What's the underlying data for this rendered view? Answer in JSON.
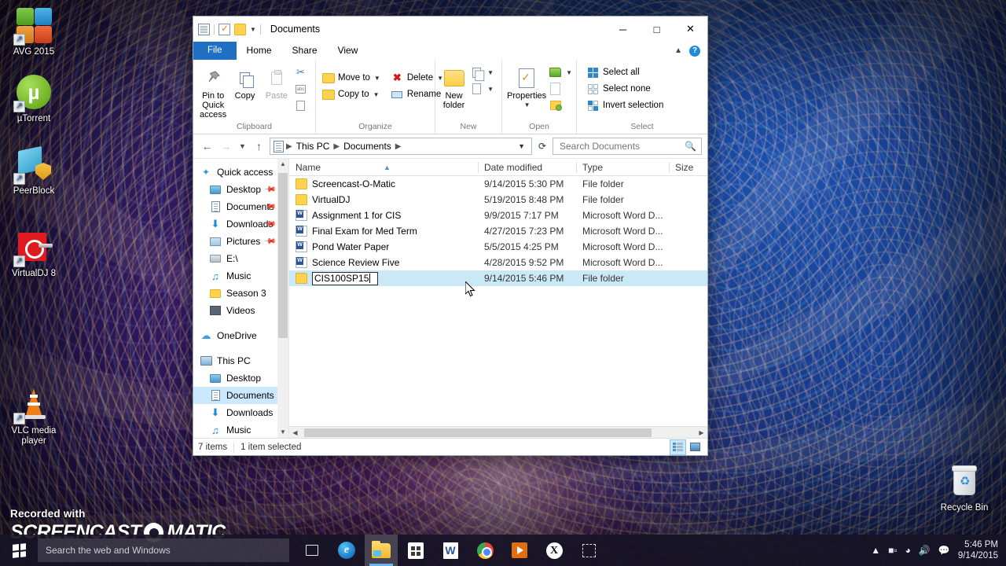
{
  "desktop": {
    "icons": [
      {
        "label": "AVG 2015",
        "icon": "avg-icon"
      },
      {
        "label": "µTorrent",
        "icon": "utorrent-icon"
      },
      {
        "label": "PeerBlock",
        "icon": "peerblock-icon"
      },
      {
        "label": "VirtualDJ 8",
        "icon": "virtualdj-icon"
      },
      {
        "label": "VLC media player",
        "icon": "vlc-icon"
      },
      {
        "label": "Recycle Bin",
        "icon": "recycle-bin-icon"
      }
    ]
  },
  "watermark": {
    "line1": "Recorded with",
    "word1": "SCREENCAST",
    "word2": "MATIC"
  },
  "explorer": {
    "title": "Documents",
    "quick_access_toolbar": [
      {
        "icon": "properties-document-icon"
      },
      {
        "icon": "checked-document-icon"
      },
      {
        "icon": "folder-icon"
      },
      {
        "icon": "chevron-down-icon"
      }
    ],
    "window_controls": {
      "minimize": "─",
      "maximize": "□",
      "close": "✕"
    },
    "tabs": [
      {
        "label": "File",
        "state": "file"
      },
      {
        "label": "Home",
        "state": "active"
      },
      {
        "label": "Share",
        "state": "normal"
      },
      {
        "label": "View",
        "state": "normal"
      }
    ],
    "ribbon": {
      "collapse_icon": "chevron-up-icon",
      "help_icon": "help-icon",
      "help_label": "?",
      "groups": [
        {
          "name": "Clipboard",
          "big_buttons": [
            {
              "label": "Pin to Quick access",
              "icon": "pin-icon",
              "disabled": false
            },
            {
              "label": "Copy",
              "icon": "copy-icon",
              "disabled": false
            },
            {
              "label": "Paste",
              "icon": "paste-icon",
              "disabled": true
            }
          ],
          "small_buttons": [
            {
              "label": "",
              "icon": "cut-scissors-icon"
            },
            {
              "label": "",
              "icon": "copy-path-icon"
            },
            {
              "label": "",
              "icon": "paste-shortcut-icon"
            }
          ]
        },
        {
          "name": "Organize",
          "small_buttons": [
            {
              "label": "Move to",
              "icon": "move-to-icon",
              "caret": true
            },
            {
              "label": "Delete",
              "icon": "delete-x-icon",
              "caret": true
            },
            {
              "label": "Copy to",
              "icon": "copy-to-icon",
              "caret": true
            },
            {
              "label": "Rename",
              "icon": "rename-icon",
              "caret": false
            }
          ]
        },
        {
          "name": "New",
          "big_buttons": [
            {
              "label": "New folder",
              "icon": "new-folder-icon"
            }
          ],
          "small_buttons": [
            {
              "label": "",
              "icon": "new-item-icon",
              "caret": true
            },
            {
              "label": "",
              "icon": "easy-access-icon",
              "caret": true
            }
          ]
        },
        {
          "name": "Open",
          "big_buttons": [
            {
              "label": "Properties",
              "icon": "properties-icon",
              "caret": true
            }
          ],
          "small_buttons": [
            {
              "label": "",
              "icon": "open-icon",
              "caret": true
            },
            {
              "label": "",
              "icon": "edit-icon",
              "caret": false
            },
            {
              "label": "",
              "icon": "history-icon",
              "caret": false
            }
          ]
        },
        {
          "name": "Select",
          "small_buttons": [
            {
              "label": "Select all",
              "icon": "select-all-icon"
            },
            {
              "label": "Select none",
              "icon": "select-none-icon"
            },
            {
              "label": "Invert selection",
              "icon": "invert-selection-icon"
            }
          ]
        }
      ]
    },
    "address_bar": {
      "back_icon": "back-arrow-icon",
      "forward_icon": "forward-arrow-icon",
      "recent_icon": "chevron-down-icon",
      "up_icon": "up-arrow-icon",
      "breadcrumb_icon": "documents-icon",
      "breadcrumbs": [
        "This PC",
        "Documents"
      ],
      "dropdown_icon": "chevron-down-icon",
      "refresh_icon": "refresh-icon",
      "search_placeholder": "Search Documents",
      "search_value": "",
      "search_icon": "search-icon"
    },
    "nav_pane": {
      "items": [
        {
          "label": "Quick access",
          "icon": "star-icon",
          "indent": false,
          "pinned": false,
          "selected": false
        },
        {
          "label": "Desktop",
          "icon": "desktop-icon",
          "indent": true,
          "pinned": true,
          "selected": false
        },
        {
          "label": "Documents",
          "icon": "documents-icon",
          "indent": true,
          "pinned": true,
          "selected": false
        },
        {
          "label": "Downloads",
          "icon": "downloads-icon",
          "indent": true,
          "pinned": true,
          "selected": false
        },
        {
          "label": "Pictures",
          "icon": "pictures-icon",
          "indent": true,
          "pinned": true,
          "selected": false
        },
        {
          "label": "E:\\",
          "icon": "drive-icon",
          "indent": true,
          "pinned": false,
          "selected": false
        },
        {
          "label": "Music",
          "icon": "music-icon",
          "indent": true,
          "pinned": false,
          "selected": false
        },
        {
          "label": "Season 3",
          "icon": "folder-icon",
          "indent": true,
          "pinned": false,
          "selected": false
        },
        {
          "label": "Videos",
          "icon": "videos-icon",
          "indent": true,
          "pinned": false,
          "selected": false
        },
        {
          "label": "OneDrive",
          "icon": "onedrive-cloud-icon",
          "indent": false,
          "pinned": false,
          "selected": false
        },
        {
          "label": "This PC",
          "icon": "this-pc-icon",
          "indent": false,
          "pinned": false,
          "selected": false
        },
        {
          "label": "Desktop",
          "icon": "desktop-icon",
          "indent": true,
          "pinned": false,
          "selected": false
        },
        {
          "label": "Documents",
          "icon": "documents-icon",
          "indent": true,
          "pinned": false,
          "selected": true
        },
        {
          "label": "Downloads",
          "icon": "downloads-icon",
          "indent": true,
          "pinned": false,
          "selected": false
        },
        {
          "label": "Music",
          "icon": "music-icon",
          "indent": true,
          "pinned": false,
          "selected": false
        }
      ]
    },
    "file_list": {
      "columns": [
        {
          "label": "Name",
          "sorted": "asc"
        },
        {
          "label": "Date modified",
          "sorted": ""
        },
        {
          "label": "Type",
          "sorted": ""
        },
        {
          "label": "Size",
          "sorted": ""
        }
      ],
      "rows": [
        {
          "name": "Screencast-O-Matic",
          "date": "9/14/2015 5:30 PM",
          "type": "File folder",
          "size": "",
          "icon": "folder-icon",
          "selected": false,
          "editing": false
        },
        {
          "name": "VirtualDJ",
          "date": "5/19/2015 8:48 PM",
          "type": "File folder",
          "size": "",
          "icon": "folder-icon",
          "selected": false,
          "editing": false
        },
        {
          "name": "Assignment 1 for CIS",
          "date": "9/9/2015 7:17 PM",
          "type": "Microsoft Word D...",
          "size": "",
          "icon": "word-document-icon",
          "selected": false,
          "editing": false
        },
        {
          "name": "Final Exam for Med Term",
          "date": "4/27/2015 7:23 PM",
          "type": "Microsoft Word D...",
          "size": "",
          "icon": "word-document-icon",
          "selected": false,
          "editing": false
        },
        {
          "name": "Pond Water Paper",
          "date": "5/5/2015 4:25 PM",
          "type": "Microsoft Word D...",
          "size": "",
          "icon": "word-document-icon",
          "selected": false,
          "editing": false
        },
        {
          "name": "Science Review Five",
          "date": "4/28/2015 9:52 PM",
          "type": "Microsoft Word D...",
          "size": "",
          "icon": "word-document-icon",
          "selected": false,
          "editing": false
        },
        {
          "name": "CIS100SP15",
          "date": "9/14/2015 5:46 PM",
          "type": "File folder",
          "size": "",
          "icon": "folder-icon",
          "selected": true,
          "editing": true
        }
      ]
    },
    "status_bar": {
      "item_count": "7 items",
      "selection": "1 item selected",
      "view_details_icon": "details-view-icon",
      "view_large_icon": "large-icons-view-icon"
    }
  },
  "taskbar": {
    "start_icon": "windows-start-icon",
    "search_placeholder": "Search the web and Windows",
    "buttons": [
      {
        "name": "task-view",
        "icon": "task-view-icon"
      },
      {
        "name": "edge",
        "icon": "edge-icon",
        "label": "e"
      },
      {
        "name": "file-explorer",
        "icon": "file-explorer-icon",
        "active": true
      },
      {
        "name": "store",
        "icon": "store-icon"
      },
      {
        "name": "word",
        "icon": "word-icon"
      },
      {
        "name": "chrome",
        "icon": "chrome-icon"
      },
      {
        "name": "movies-tv",
        "icon": "movies-tv-icon"
      },
      {
        "name": "xbox",
        "icon": "xbox-icon"
      },
      {
        "name": "snip",
        "icon": "dashed-square-icon"
      }
    ],
    "tray": {
      "show_hidden_icon": "chevron-up-icon",
      "battery_icon": "battery-icon",
      "wifi_icon": "wifi-icon",
      "volume_icon": "volume-icon",
      "action_center_icon": "action-center-icon",
      "time": "5:46 PM",
      "date": "9/14/2015"
    }
  },
  "colors": {
    "accent": "#1f6fc4",
    "selection": "#cbe8f6",
    "folder": "#ffd24d",
    "taskbar": "#171426"
  }
}
